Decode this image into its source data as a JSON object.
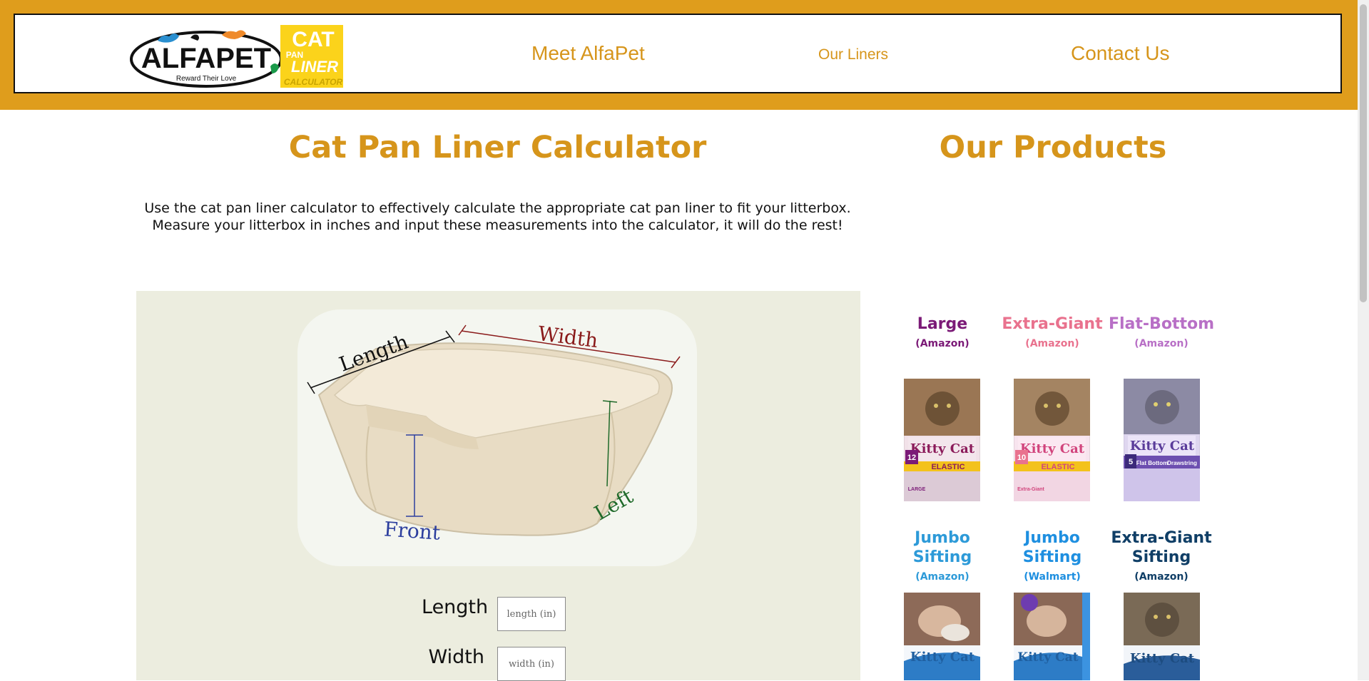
{
  "header": {
    "logo": {
      "brand": "ALFAPET",
      "tagline": "Reward Their Love",
      "badge_line1": "CAT",
      "badge_line2": "PAN",
      "badge_line3": "LINER",
      "badge_line4": "CALCULATOR"
    },
    "nav": [
      {
        "label": "Meet AlfaPet"
      },
      {
        "label": "Our Liners"
      },
      {
        "label": "Contact Us"
      }
    ]
  },
  "calculator": {
    "title": "Cat Pan Liner Calculator",
    "intro_line1": "Use the cat pan liner calculator to effectively calculate the appropriate cat pan liner to fit your litterbox.",
    "intro_line2": "Measure your litterbox in inches and input these measurements into the calculator, it will do the rest!",
    "diagram": {
      "length": "Length",
      "width": "Width",
      "front": "Front",
      "left": "Left"
    },
    "fields": [
      {
        "label": "Length",
        "placeholder": "length (in)",
        "value": ""
      },
      {
        "label": "Width",
        "placeholder": "width (in)",
        "value": ""
      }
    ]
  },
  "products": {
    "title": "Our Products",
    "items": [
      {
        "name": "Large",
        "store": "(Amazon)",
        "color": "#7b1a77",
        "box_brand": "Kitty Cat",
        "box_tag": "ELASTIC",
        "box_count": "12",
        "box_size": "LARGE"
      },
      {
        "name": "Extra-Giant",
        "store": "(Amazon)",
        "color": "#e9728e",
        "box_brand": "Kitty Cat",
        "box_tag": "ELASTIC",
        "box_count": "10",
        "box_size": "Extra-Giant"
      },
      {
        "name": "Flat-Bottom",
        "store": "(Amazon)",
        "color": "#b86fc6",
        "box_brand": "Kitty Cat",
        "box_tag": "Flat Bottom",
        "box_count": "5",
        "box_size": "Drawstring"
      },
      {
        "name": "Jumbo Sifting",
        "store": "(Amazon)",
        "color": "#2d9ad8",
        "box_brand": "Kitty Cat"
      },
      {
        "name": "Jumbo Sifting",
        "store": "(Walmart)",
        "color": "#1e8fe0",
        "box_brand": "Kitty Cat"
      },
      {
        "name": "Extra-Giant Sifting",
        "store": "(Amazon)",
        "color": "#0f3e66",
        "box_brand": "Kitty Cat"
      }
    ]
  },
  "colors": {
    "brand_orange": "#df9d1c",
    "heading_orange": "#d6951b",
    "panel_bg": "#eceddf"
  }
}
